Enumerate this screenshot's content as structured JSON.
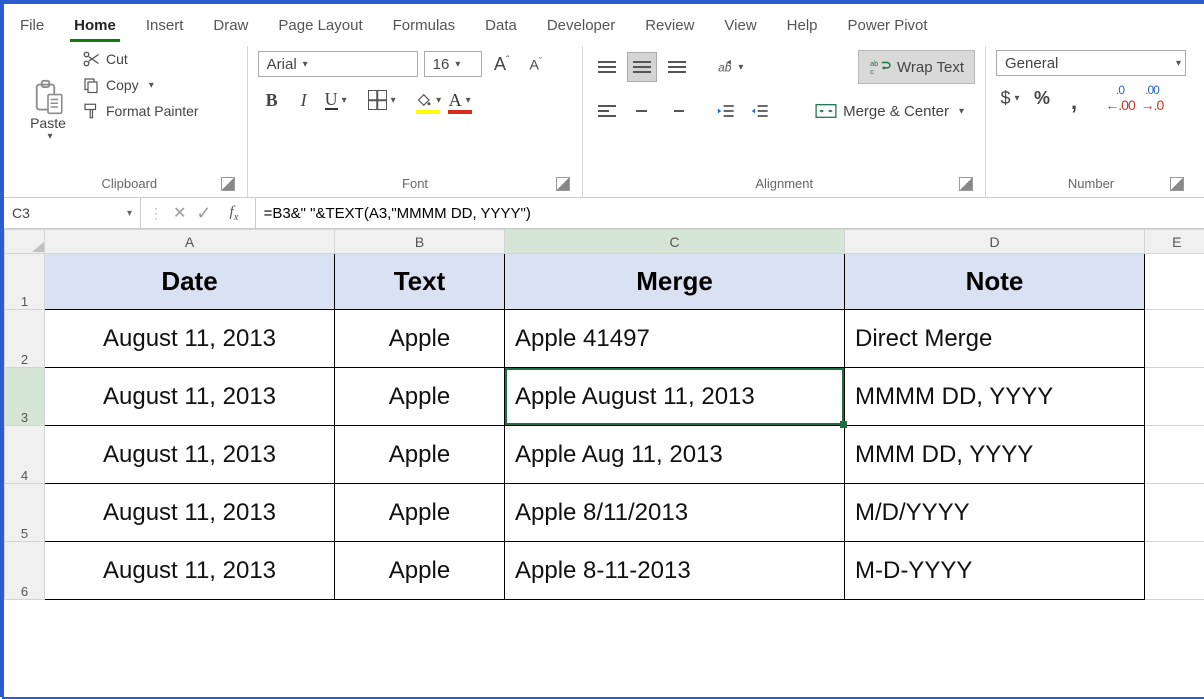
{
  "ribbon_tabs": [
    "File",
    "Home",
    "Insert",
    "Draw",
    "Page Layout",
    "Formulas",
    "Data",
    "Developer",
    "Review",
    "View",
    "Help",
    "Power Pivot"
  ],
  "active_tab": "Home",
  "clipboard": {
    "paste_label": "Paste",
    "cut_label": "Cut",
    "copy_label": "Copy",
    "format_painter_label": "Format Painter",
    "group_label": "Clipboard"
  },
  "font": {
    "name": "Arial",
    "size": "16",
    "group_label": "Font",
    "bold": "B",
    "italic": "I",
    "underline": "U",
    "increase": "A",
    "decrease": "A",
    "font_color_letter": "A"
  },
  "alignment": {
    "wrap_text_label": "Wrap Text",
    "merge_center_label": "Merge & Center",
    "group_label": "Alignment"
  },
  "number": {
    "format": "General",
    "group_label": "Number",
    "currency": "$",
    "percent": "%",
    "comma": ","
  },
  "name_box": "C3",
  "formula": "=B3&\" \"&TEXT(A3,\"MMMM DD, YYYY\")",
  "columns": [
    "A",
    "B",
    "C",
    "D",
    "E"
  ],
  "selected_col": "C",
  "selected_row": "3",
  "sheet": {
    "headers": {
      "A": "Date",
      "B": "Text",
      "C": "Merge",
      "D": "Note"
    },
    "rows": [
      {
        "n": "2",
        "A": "August 11, 2013",
        "B": "Apple",
        "C": "Apple 41497",
        "D": "Direct Merge"
      },
      {
        "n": "3",
        "A": "August 11, 2013",
        "B": "Apple",
        "C": "Apple August 11, 2013",
        "D": "MMMM DD, YYYY"
      },
      {
        "n": "4",
        "A": "August 11, 2013",
        "B": "Apple",
        "C": "Apple Aug 11, 2013",
        "D": "MMM DD, YYYY"
      },
      {
        "n": "5",
        "A": "August 11, 2013",
        "B": "Apple",
        "C": "Apple 8/11/2013",
        "D": "M/D/YYYY"
      },
      {
        "n": "6",
        "A": "August 11, 2013",
        "B": "Apple",
        "C": "Apple 8-11-2013",
        "D": "M-D-YYYY"
      }
    ]
  }
}
